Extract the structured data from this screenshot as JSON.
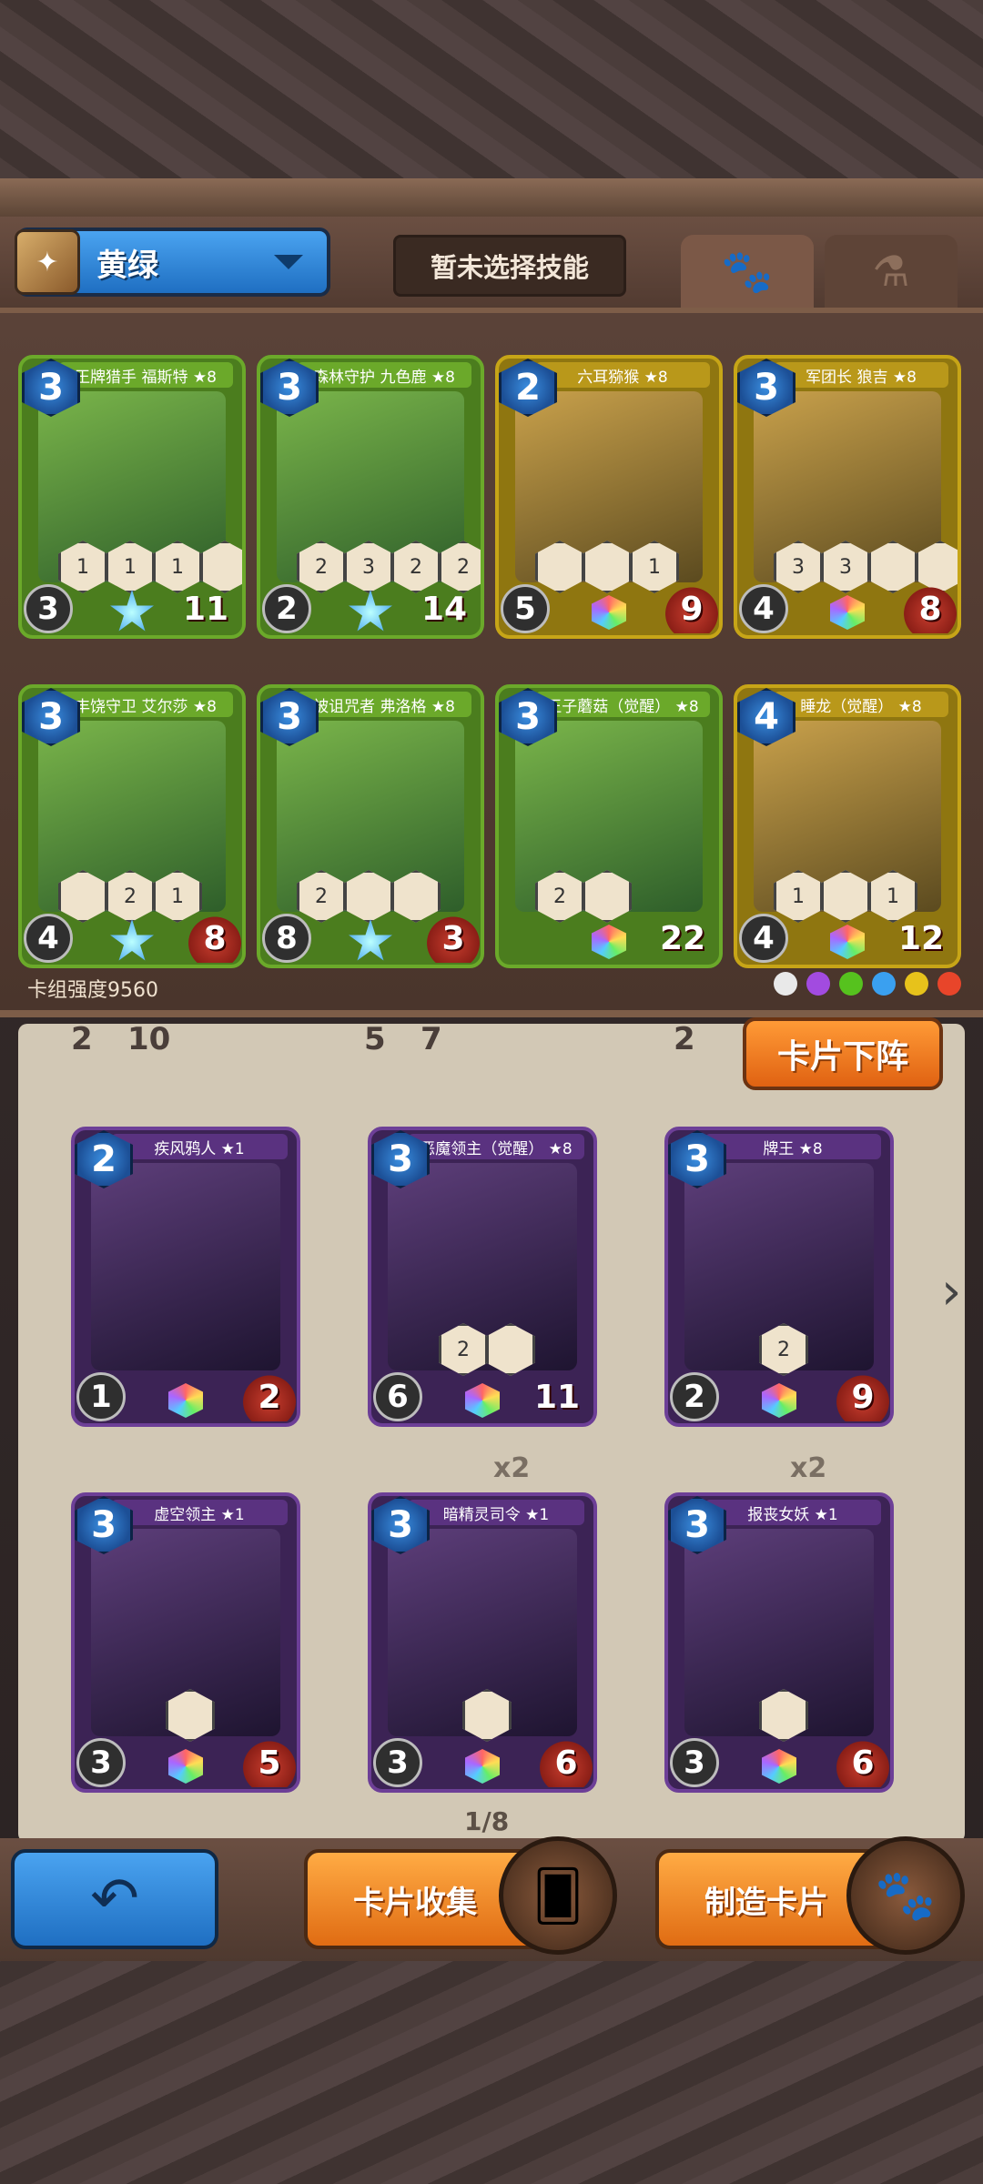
{
  "deck": {
    "name": "黄绿",
    "skill_text": "暂未选择技能",
    "power_label": "卡组强度9560"
  },
  "tabs": {
    "paw_icon": "paw-icon",
    "potion_icon": "potion-icon"
  },
  "buttons": {
    "remove": "卡片下阵",
    "collect": "卡片收集",
    "craft": "制造卡片",
    "back_icon": "↶"
  },
  "pagination": "1/8",
  "deck_cards": [
    {
      "name": "王牌猎手 福斯特 ★8",
      "cost": "3",
      "atk": "3",
      "hp": "11",
      "color": "green",
      "skills": [
        "1",
        "1",
        "1",
        ""
      ]
    },
    {
      "name": "森林守护 九色鹿 ★8",
      "cost": "3",
      "atk": "2",
      "hp": "14",
      "color": "green",
      "skills": [
        "2",
        "3",
        "2",
        "2"
      ]
    },
    {
      "name": "六耳猕猴 ★8",
      "cost": "2",
      "atk": "5",
      "hp": "9",
      "color": "yellow",
      "skills": [
        "",
        "",
        "1"
      ]
    },
    {
      "name": "军团长 狼吉 ★8",
      "cost": "3",
      "atk": "4",
      "hp": "8",
      "color": "yellow",
      "skills": [
        "3",
        "3",
        "",
        ""
      ]
    },
    {
      "name": "丰饶守卫 艾尔莎 ★8",
      "cost": "3",
      "atk": "4",
      "hp": "8",
      "color": "green",
      "skills": [
        "",
        "2",
        "1"
      ]
    },
    {
      "name": "被诅咒者 弗洛格 ★8",
      "cost": "3",
      "atk": "8",
      "hp": "3",
      "color": "green",
      "skills": [
        "2",
        "",
        ""
      ]
    },
    {
      "name": "王子蘑菇（觉醒） ★8",
      "cost": "3",
      "atk": "",
      "hp": "22",
      "color": "green",
      "skills": [
        "2",
        ""
      ]
    },
    {
      "name": "睡龙（觉醒） ★8",
      "cost": "4",
      "atk": "4",
      "hp": "12",
      "color": "yellow",
      "skills": [
        "1",
        "",
        "1"
      ]
    }
  ],
  "partial_row": [
    "2",
    "10",
    "5",
    "7",
    "2"
  ],
  "collection_cards": [
    {
      "name": "疾风鸦人 ★1",
      "cost": "2",
      "atk": "1",
      "hp": "2",
      "count": "",
      "skills": []
    },
    {
      "name": "恶魔领主（觉醒） ★8",
      "cost": "3",
      "atk": "6",
      "hp": "11",
      "count": "",
      "skills": [
        "2",
        ""
      ]
    },
    {
      "name": "牌王 ★8",
      "cost": "3",
      "atk": "2",
      "hp": "9",
      "count": "",
      "skills": [
        "2"
      ]
    },
    {
      "name": "虚空领主 ★1",
      "cost": "3",
      "atk": "3",
      "hp": "5",
      "count": "",
      "skills": [
        ""
      ]
    },
    {
      "name": "暗精灵司令 ★1",
      "cost": "3",
      "atk": "3",
      "hp": "6",
      "count": "x2",
      "skills": [
        ""
      ]
    },
    {
      "name": "报丧女妖 ★1",
      "cost": "3",
      "atk": "3",
      "hp": "6",
      "count": "x2",
      "skills": [
        ""
      ]
    }
  ],
  "faction_colors": [
    "#e9e9e9",
    "#a24be0",
    "#56c21e",
    "#3aa0f0",
    "#e7c21b",
    "#e8452a"
  ]
}
